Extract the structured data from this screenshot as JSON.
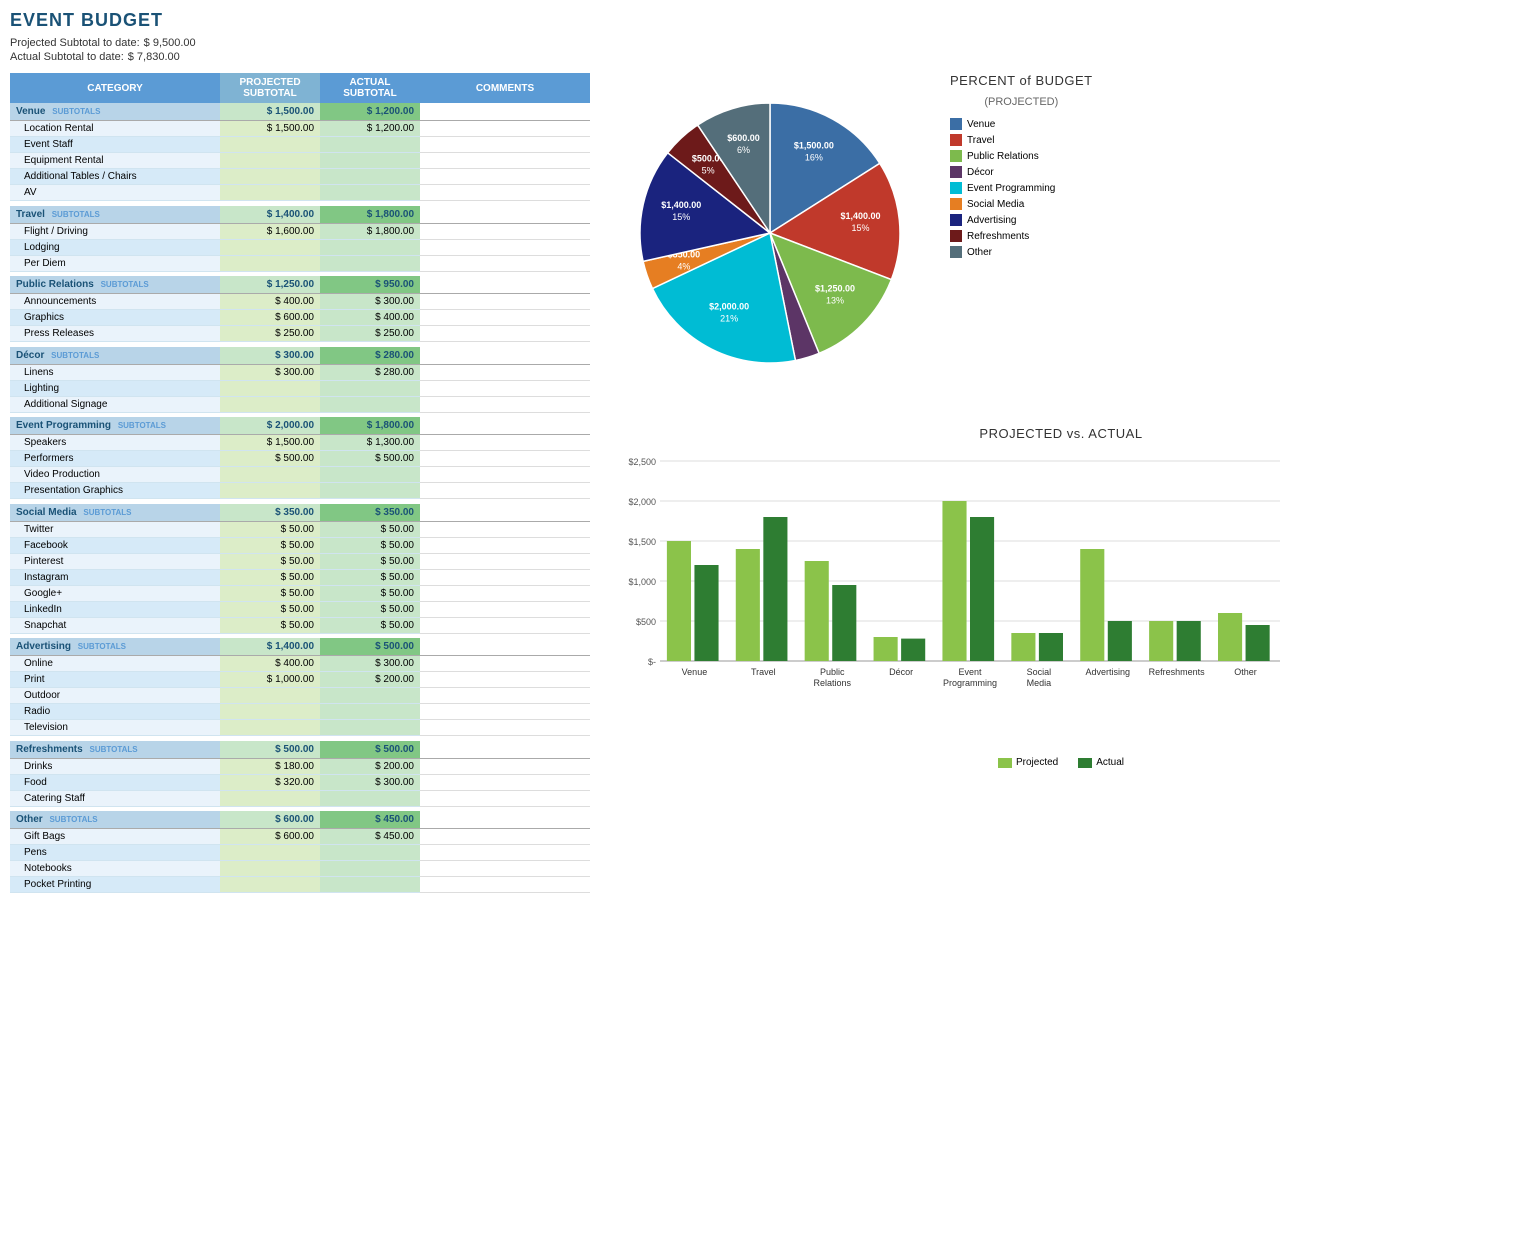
{
  "title": "EVENT BUDGET",
  "projected_subtitle": "Projected Subtotal to date:",
  "actual_subtitle": "Actual Subtotal to date:",
  "projected_total": "$    9,500.00",
  "actual_total": "$    7,830.00",
  "table": {
    "headers": [
      "CATEGORY",
      "PROJECTED SUBTOTAL",
      "ACTUAL SUBTOTAL",
      "COMMENTS"
    ],
    "sections": [
      {
        "name": "Venue",
        "projected": "$ 1,500.00",
        "actual": "$ 1,200.00",
        "items": [
          {
            "name": "Location Rental",
            "projected": "$ 1,500.00",
            "actual": "$ 1,200.00"
          },
          {
            "name": "Event Staff",
            "projected": "",
            "actual": ""
          },
          {
            "name": "Equipment Rental",
            "projected": "",
            "actual": ""
          },
          {
            "name": "Additional Tables / Chairs",
            "projected": "",
            "actual": ""
          },
          {
            "name": "AV",
            "projected": "",
            "actual": ""
          }
        ]
      },
      {
        "name": "Travel",
        "projected": "$ 1,400.00",
        "actual": "$ 1,800.00",
        "items": [
          {
            "name": "Flight / Driving",
            "projected": "$ 1,600.00",
            "actual": "$ 1,800.00"
          },
          {
            "name": "Lodging",
            "projected": "",
            "actual": ""
          },
          {
            "name": "Per Diem",
            "projected": "",
            "actual": ""
          }
        ]
      },
      {
        "name": "Public Relations",
        "projected": "$ 1,250.00",
        "actual": "$ 950.00",
        "items": [
          {
            "name": "Announcements",
            "projected": "$ 400.00",
            "actual": "$ 300.00"
          },
          {
            "name": "Graphics",
            "projected": "$ 600.00",
            "actual": "$ 400.00"
          },
          {
            "name": "Press Releases",
            "projected": "$ 250.00",
            "actual": "$ 250.00"
          }
        ]
      },
      {
        "name": "Décor",
        "projected": "$ 300.00",
        "actual": "$ 280.00",
        "items": [
          {
            "name": "Linens",
            "projected": "$ 300.00",
            "actual": "$ 280.00"
          },
          {
            "name": "Lighting",
            "projected": "",
            "actual": ""
          },
          {
            "name": "Additional Signage",
            "projected": "",
            "actual": ""
          }
        ]
      },
      {
        "name": "Event Programming",
        "projected": "$ 2,000.00",
        "actual": "$ 1,800.00",
        "items": [
          {
            "name": "Speakers",
            "projected": "$ 1,500.00",
            "actual": "$ 1,300.00"
          },
          {
            "name": "Performers",
            "projected": "$ 500.00",
            "actual": "$ 500.00"
          },
          {
            "name": "Video Production",
            "projected": "",
            "actual": ""
          },
          {
            "name": "Presentation Graphics",
            "projected": "",
            "actual": ""
          }
        ]
      },
      {
        "name": "Social Media",
        "projected": "$ 350.00",
        "actual": "$ 350.00",
        "items": [
          {
            "name": "Twitter",
            "projected": "$ 50.00",
            "actual": "$ 50.00"
          },
          {
            "name": "Facebook",
            "projected": "$ 50.00",
            "actual": "$ 50.00"
          },
          {
            "name": "Pinterest",
            "projected": "$ 50.00",
            "actual": "$ 50.00"
          },
          {
            "name": "Instagram",
            "projected": "$ 50.00",
            "actual": "$ 50.00"
          },
          {
            "name": "Google+",
            "projected": "$ 50.00",
            "actual": "$ 50.00"
          },
          {
            "name": "LinkedIn",
            "projected": "$ 50.00",
            "actual": "$ 50.00"
          },
          {
            "name": "Snapchat",
            "projected": "$ 50.00",
            "actual": "$ 50.00"
          }
        ]
      },
      {
        "name": "Advertising",
        "projected": "$ 1,400.00",
        "actual": "$ 500.00",
        "items": [
          {
            "name": "Online",
            "projected": "$ 400.00",
            "actual": "$ 300.00"
          },
          {
            "name": "Print",
            "projected": "$ 1,000.00",
            "actual": "$ 200.00"
          },
          {
            "name": "Outdoor",
            "projected": "",
            "actual": ""
          },
          {
            "name": "Radio",
            "projected": "",
            "actual": ""
          },
          {
            "name": "Television",
            "projected": "",
            "actual": ""
          }
        ]
      },
      {
        "name": "Refreshments",
        "projected": "$ 500.00",
        "actual": "$ 500.00",
        "items": [
          {
            "name": "Drinks",
            "projected": "$ 180.00",
            "actual": "$ 200.00"
          },
          {
            "name": "Food",
            "projected": "$ 320.00",
            "actual": "$ 300.00"
          },
          {
            "name": "Catering Staff",
            "projected": "",
            "actual": ""
          }
        ]
      },
      {
        "name": "Other",
        "projected": "$ 600.00",
        "actual": "$ 450.00",
        "items": [
          {
            "name": "Gift Bags",
            "projected": "$ 600.00",
            "actual": "$ 450.00"
          },
          {
            "name": "Pens",
            "projected": "",
            "actual": ""
          },
          {
            "name": "Notebooks",
            "projected": "",
            "actual": ""
          },
          {
            "name": "Pocket Printing",
            "projected": "",
            "actual": ""
          }
        ]
      }
    ]
  },
  "pie_chart": {
    "title": "PERCENT of BUDGET",
    "subtitle": "(PROJECTED)",
    "segments": [
      {
        "label": "Venue",
        "value": 1500,
        "pct": 16,
        "color": "#3b6ea5",
        "angle_start": 0,
        "angle_end": 57.6
      },
      {
        "label": "Travel",
        "value": 1400,
        "pct": 15,
        "color": "#c0392b",
        "angle_start": 57.6,
        "angle_end": 111
      },
      {
        "label": "Public Relations",
        "value": 1250,
        "pct": 13,
        "color": "#7dba4d",
        "angle_start": 111,
        "angle_end": 157.8
      },
      {
        "label": "Décor",
        "value": 300,
        "pct": 3,
        "color": "#5c3566",
        "angle_start": 157.8,
        "angle_end": 168.7
      },
      {
        "label": "Event Programming",
        "value": 2000,
        "pct": 21,
        "color": "#00bcd4",
        "angle_start": 168.7,
        "angle_end": 244.7
      },
      {
        "label": "Social Media",
        "value": 350,
        "pct": 4,
        "color": "#e67e22",
        "angle_start": 244.7,
        "angle_end": 257.4
      },
      {
        "label": "Advertising",
        "value": 1400,
        "pct": 15,
        "color": "#1a237e",
        "angle_start": 257.4,
        "angle_end": 308.1
      },
      {
        "label": "Refreshments",
        "value": 500,
        "pct": 5,
        "color": "#6d1a1a",
        "angle_start": 308.1,
        "angle_end": 326.2
      },
      {
        "label": "Other",
        "value": 600,
        "pct": 6,
        "color": "#546e7a",
        "angle_start": 326.2,
        "angle_end": 360
      }
    ]
  },
  "bar_chart": {
    "title": "PROJECTED vs. ACTUAL",
    "y_labels": [
      "$2,500",
      "$2,000",
      "$1,500",
      "$1,000",
      "$500",
      "$-"
    ],
    "categories": [
      "Venue",
      "Travel",
      "Public Relations",
      "Décor",
      "Event Programming",
      "Social Media",
      "Advertising",
      "Refreshments",
      "Other"
    ],
    "projected": [
      1500,
      1400,
      1250,
      300,
      2000,
      350,
      1400,
      500,
      600
    ],
    "actual": [
      1200,
      1800,
      950,
      280,
      1800,
      350,
      500,
      500,
      450
    ],
    "projected_color": "#8bc34a",
    "actual_color": "#2e7d32",
    "legend_projected": "Projected",
    "legend_actual": "Actual"
  }
}
